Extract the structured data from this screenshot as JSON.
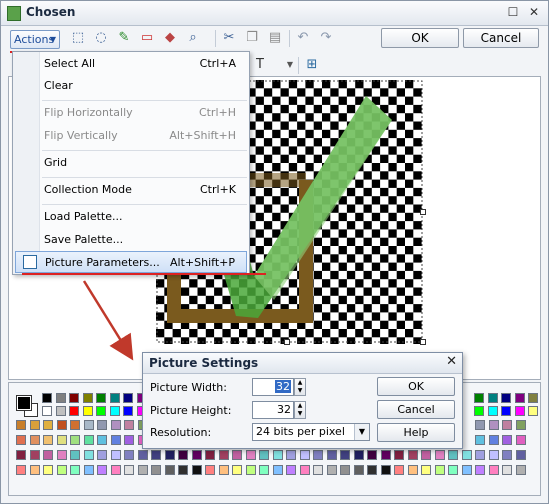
{
  "window": {
    "title": "Chosen",
    "ok_label": "OK",
    "cancel_label": "Cancel",
    "actions_label": "Actions"
  },
  "toolbar_icons": [
    "select-rect-icon",
    "lasso-icon",
    "pipette-icon",
    "eraser-icon",
    "fill-icon",
    "zoom-icon",
    "cut-icon",
    "copy-icon",
    "paste-icon",
    "undo-icon",
    "redo-icon"
  ],
  "menu": {
    "items": [
      {
        "label": "Select All",
        "shortcut": "Ctrl+A",
        "disabled": false
      },
      {
        "label": "Clear",
        "shortcut": "",
        "disabled": false
      },
      {
        "label": "Flip Horizontally",
        "shortcut": "Ctrl+H",
        "disabled": true
      },
      {
        "label": "Flip Vertically",
        "shortcut": "Alt+Shift+H",
        "disabled": true
      },
      {
        "label": "Grid",
        "shortcut": "",
        "disabled": false
      },
      {
        "label": "Collection Mode",
        "shortcut": "Ctrl+K",
        "disabled": false
      },
      {
        "label": "Load Palette...",
        "shortcut": "",
        "disabled": false
      },
      {
        "label": "Save Palette...",
        "shortcut": "",
        "disabled": false
      },
      {
        "label": "Picture Parameters...",
        "shortcut": "Alt+Shift+P",
        "disabled": false
      }
    ]
  },
  "dialog": {
    "title": "Picture Settings",
    "width_label": "Picture Width:",
    "width_value": "32",
    "height_label": "Picture Height:",
    "height_value": "32",
    "resolution_label": "Resolution:",
    "resolution_value": "24 bits per pixel",
    "ok_label": "OK",
    "cancel_label": "Cancel",
    "help_label": "Help"
  },
  "colors": {
    "accent": "#1d4c9a",
    "highlight_red": "#dd2222",
    "check_green": "#4aa83a",
    "frame_brown": "#7a5a1e"
  }
}
